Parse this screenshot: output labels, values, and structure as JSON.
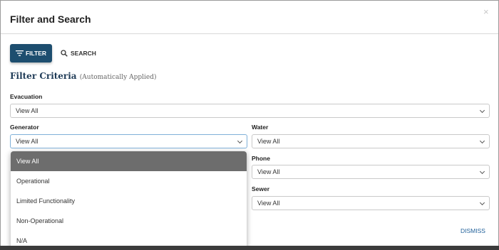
{
  "dialog": {
    "title": "Filter and Search",
    "close": "×"
  },
  "mode_tabs": {
    "filter_label": "FILTER",
    "search_label": "SEARCH"
  },
  "criteria": {
    "heading": "Filter Criteria",
    "subheading": "(Automatically Applied)"
  },
  "fields": {
    "evacuation": {
      "label": "Evacuation",
      "value": "View All"
    },
    "generator": {
      "label": "Generator",
      "value": "View All"
    },
    "water": {
      "label": "Water",
      "value": "View All"
    },
    "phone": {
      "label": "Phone",
      "value": "View All"
    },
    "sewer": {
      "label": "Sewer",
      "value": "View All"
    }
  },
  "generator_dropdown": {
    "options": [
      "View All",
      "Operational",
      "Limited Functionality",
      "Non-Operational",
      "N/A"
    ],
    "selected": "View All"
  },
  "footer": {
    "dismiss_label": "DISMISS"
  },
  "colors": {
    "primary": "#1d4e6f",
    "link": "#1f5f99",
    "selected_option": "#6d6d6d"
  }
}
